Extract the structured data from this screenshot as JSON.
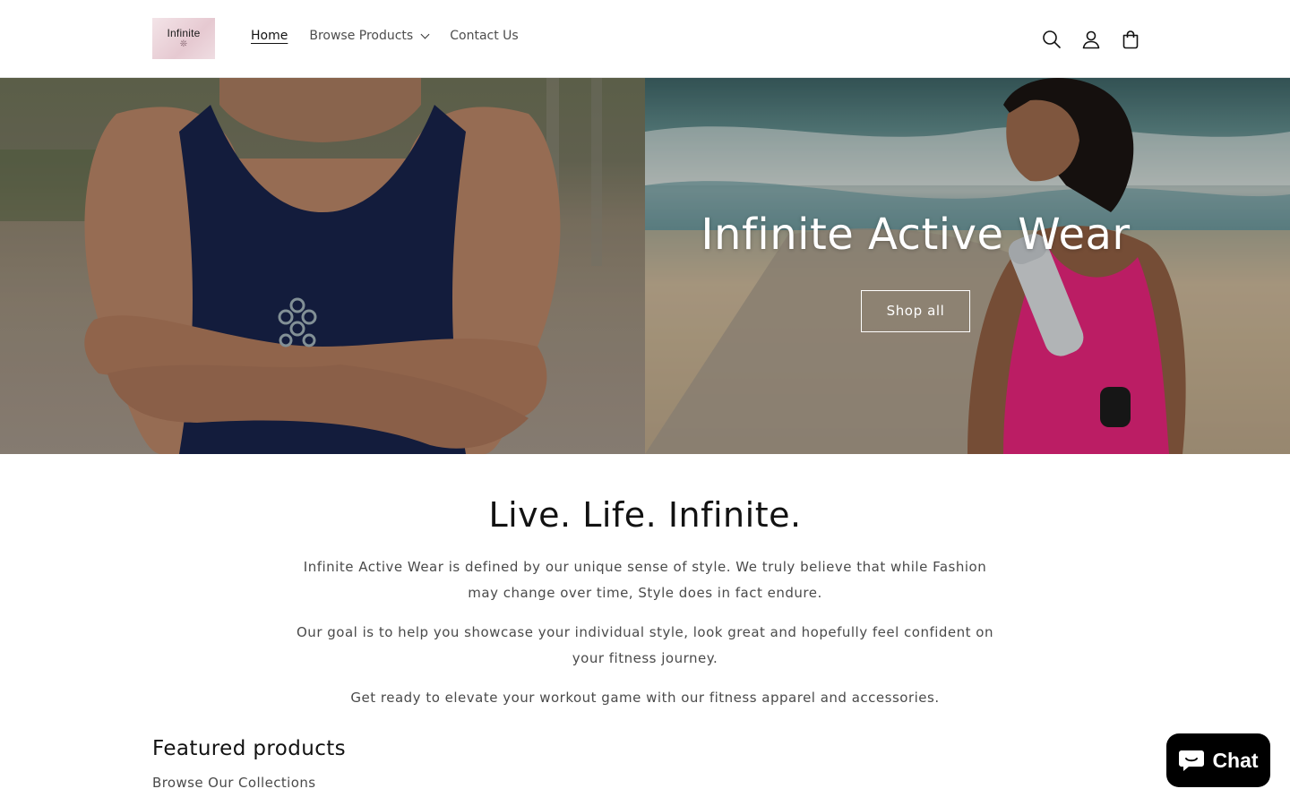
{
  "header": {
    "logo_text": "Infinite",
    "logo_mark": "❊",
    "nav": [
      {
        "label": "Home",
        "active": true
      },
      {
        "label": "Browse Products",
        "has_dropdown": true
      },
      {
        "label": "Contact Us"
      }
    ],
    "icons": [
      "search-icon",
      "account-icon",
      "cart-icon"
    ]
  },
  "hero": {
    "title": "Infinite Active Wear",
    "button_label": "Shop all"
  },
  "about": {
    "title": "Live. Life. Infinite.",
    "paragraphs": [
      "Infinite Active Wear is defined by our unique sense of style. We truly believe that while Fashion may change over time, Style does in fact endure.",
      "Our goal is to help you showcase your individual style, look great and hopefully feel confident on your fitness journey.",
      "Get ready to elevate your workout game with our fitness apparel and accessories."
    ]
  },
  "featured": {
    "title": "Featured products",
    "subtitle": "Browse Our Collections"
  },
  "chat": {
    "label": "Chat"
  },
  "colors": {
    "text": "#121212",
    "muted": "#4a4a4a",
    "chat_bg": "#000000"
  }
}
